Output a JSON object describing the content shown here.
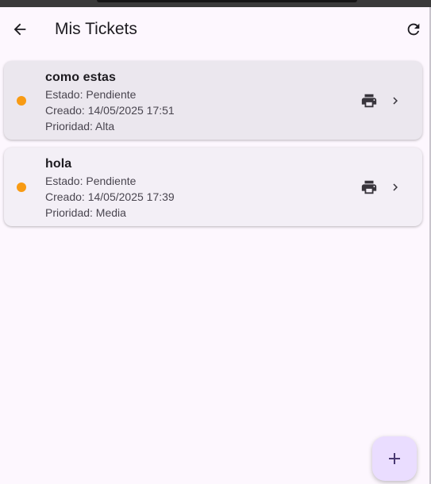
{
  "app_bar": {
    "title": "Mis Tickets",
    "back_icon": "arrow-back-icon",
    "refresh_icon": "refresh-icon"
  },
  "tickets": [
    {
      "title": "como estas",
      "estado": "Estado: Pendiente",
      "creado": "Creado: 14/05/2025 17:51",
      "prioridad": "Prioridad: Alta",
      "status_color": "#f89b14"
    },
    {
      "title": "hola",
      "estado": "Estado: Pendiente",
      "creado": "Creado: 14/05/2025 17:39",
      "prioridad": "Prioridad: Media",
      "status_color": "#f89b14"
    }
  ],
  "fab": {
    "icon": "add-icon",
    "color": "#eaddff"
  },
  "colors": {
    "background": "#fdf7fe",
    "card": "#f3eff6",
    "status_pending": "#f89b14",
    "accent": "#4a3a73"
  }
}
